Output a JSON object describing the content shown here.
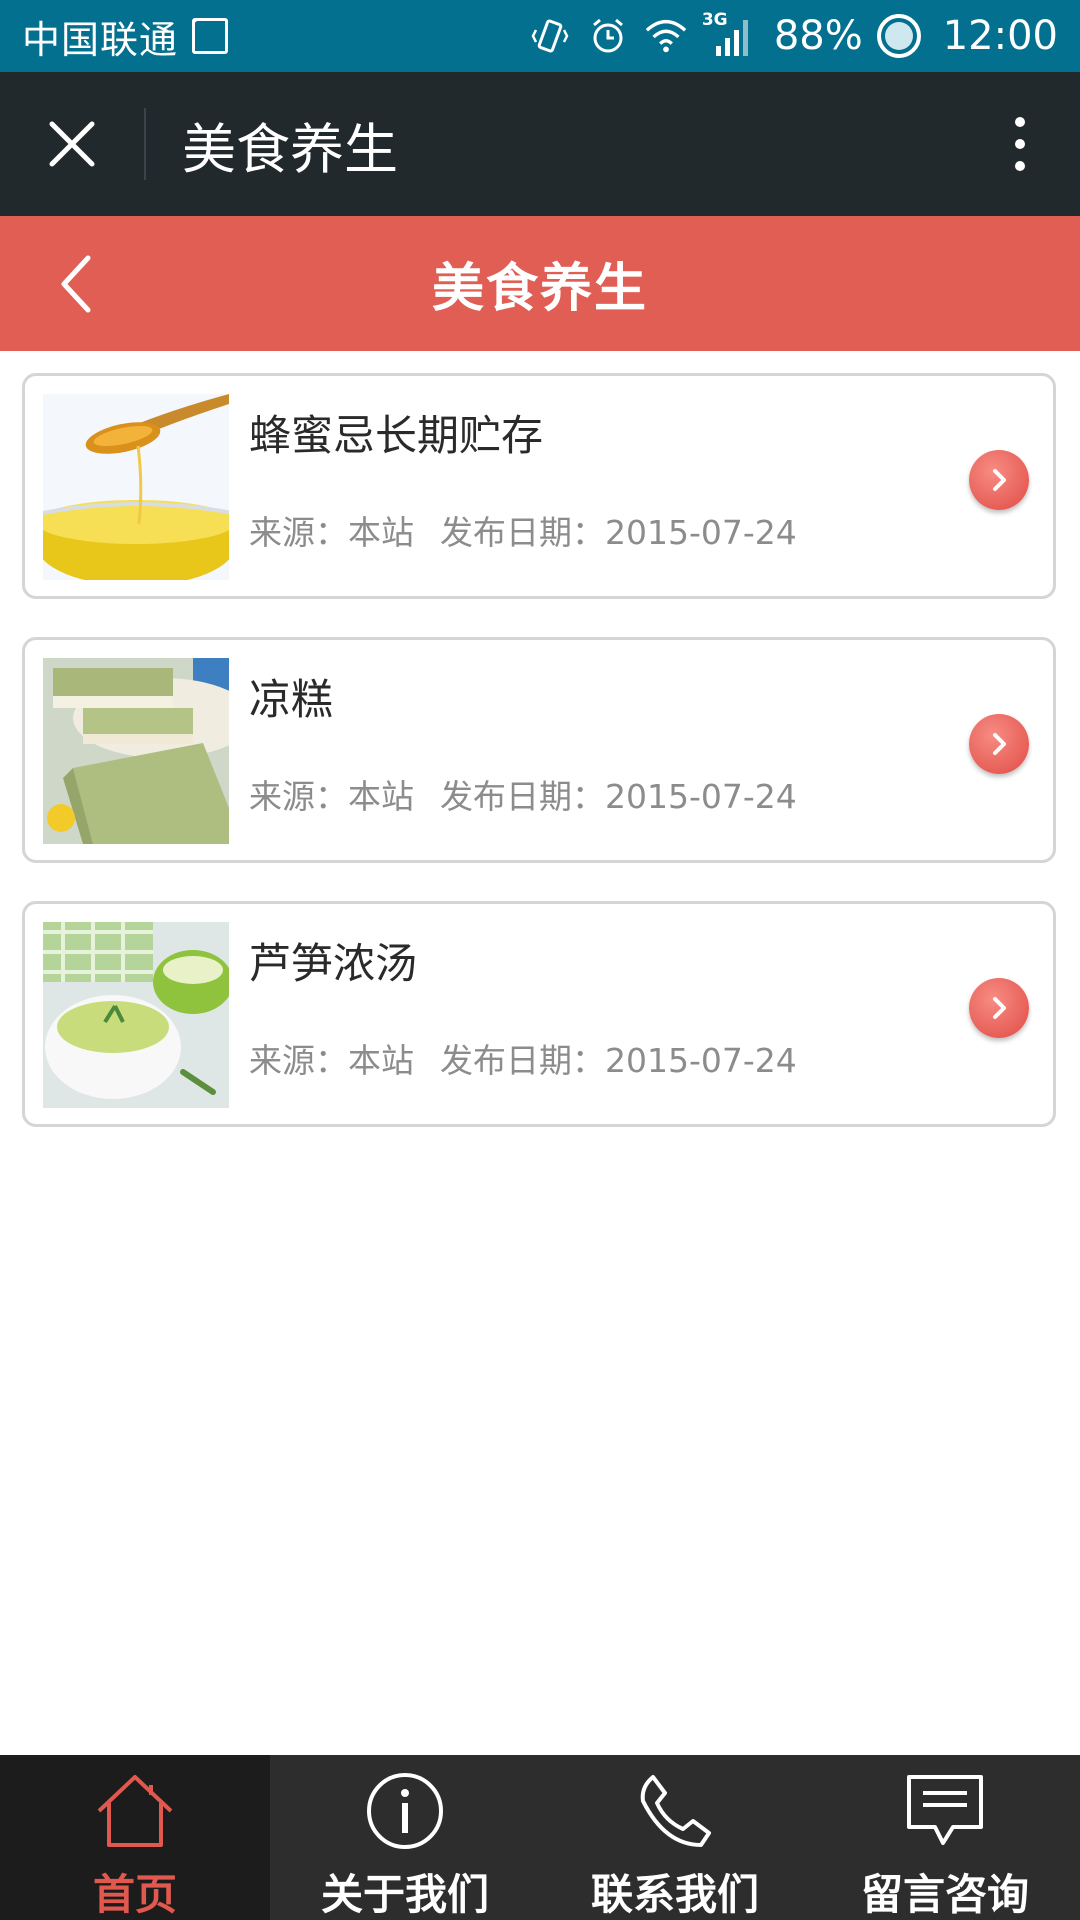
{
  "status_bar": {
    "carrier": "中国联通",
    "network": "3G",
    "battery": "88%",
    "time": "12:00"
  },
  "wechat_bar": {
    "title": "美食养生"
  },
  "header": {
    "title": "美食养生"
  },
  "articles": [
    {
      "title": "蜂蜜忌长期贮存",
      "source": "来源：本站",
      "date": "发布日期：2015-07-24",
      "thumb": "honey-image"
    },
    {
      "title": "凉糕",
      "source": "来源：本站",
      "date": "发布日期：2015-07-24",
      "thumb": "cake-image"
    },
    {
      "title": "芦笋浓汤",
      "source": "来源：本站",
      "date": "发布日期：2015-07-24",
      "thumb": "soup-image"
    }
  ],
  "nav": [
    {
      "label": "首页",
      "icon": "home-icon",
      "active": true
    },
    {
      "label": "关于我们",
      "icon": "info-icon",
      "active": false
    },
    {
      "label": "联系我们",
      "icon": "phone-icon",
      "active": false
    },
    {
      "label": "留言咨询",
      "icon": "message-icon",
      "active": false
    }
  ],
  "colors": {
    "status_bar": "#04708f",
    "wechat_bar": "#22292c",
    "accent": "#e05e54",
    "nav_bg": "#2d2d2d",
    "nav_active_bg": "#1c1c1c"
  }
}
